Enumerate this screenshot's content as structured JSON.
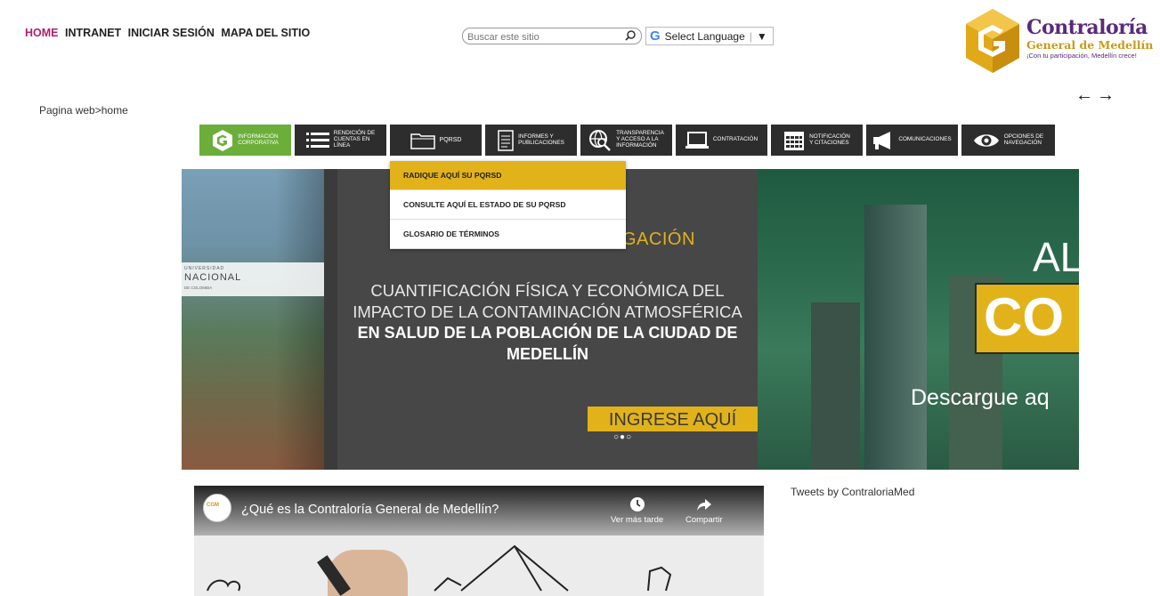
{
  "header": {
    "links": [
      "HOME",
      "INTRANET",
      "INICIAR SESIÓN",
      "MAPA DEL SITIO"
    ],
    "search_placeholder": "Buscar este sitio",
    "language_label": "Select Language",
    "language_g": "G",
    "logo": {
      "brand": "Contraloría",
      "sub": "General de Medellín",
      "tagline": "¡Con tu participación, Medellín crece!"
    },
    "arrows": "🡄 🡆"
  },
  "breadcrumb": "Pagina web>home",
  "nav": [
    {
      "label": "INFORMACIÓN\nCORPORATIVA",
      "icon": "contraloria-logo-icon"
    },
    {
      "label": "RENDICIÓN DE\nCUENTAS EN\nLÍNEA",
      "icon": "list-icon"
    },
    {
      "label": "PQRSD",
      "icon": "folder-icon"
    },
    {
      "label": "INFORMES Y\nPUBLICACIONES",
      "icon": "document-icon"
    },
    {
      "label": "TRANSPARENCIA\nY ACCESO A LA\nINFORMACIÓN",
      "icon": "globe-search-icon"
    },
    {
      "label": "CONTRATACIÓN",
      "icon": "laptop-icon"
    },
    {
      "label": "NOTIFICACIÓN\nY CITACIONES",
      "icon": "calendar-icon"
    },
    {
      "label": "COMUNICACIONES",
      "icon": "megaphone-icon"
    },
    {
      "label": "OPCIONES DE\nNAVEGACIÓN",
      "icon": "eye-icon"
    }
  ],
  "dropdown": [
    "RADIQUE AQUÍ SU PQRSD",
    "CONSULTE AQUÍ EL ESTADO DE SU PQRSD",
    "GLOSARIO DE TÉRMINOS"
  ],
  "banner": {
    "uni_small": "UNIVERSIDAD",
    "uni_name": "NACIONAL",
    "uni_sub": "DE COLOMBIA",
    "investigacion": "GACIÓN",
    "line1": "CUANTIFICACIÓN FÍSICA Y ECONÓMICA DEL",
    "line2": "IMPACTO  DE LA CONTAMINACIÓN ATMOSFÉRICA",
    "line3": "EN SALUD DE LA POBLACIÓN DE LA CIUDAD DE",
    "line4": "MEDELLÍN",
    "cta": "INGRESE AQUÍ",
    "dots": "○●○",
    "right_al": "AL",
    "right_co": "CO",
    "right_desc": "Descargue aq"
  },
  "video": {
    "title": "¿Qué es la Contraloría General de Medellín?",
    "watch_later": "Ver más tarde",
    "share": "Compartir"
  },
  "tweets": "Tweets by ContraloriaMed"
}
